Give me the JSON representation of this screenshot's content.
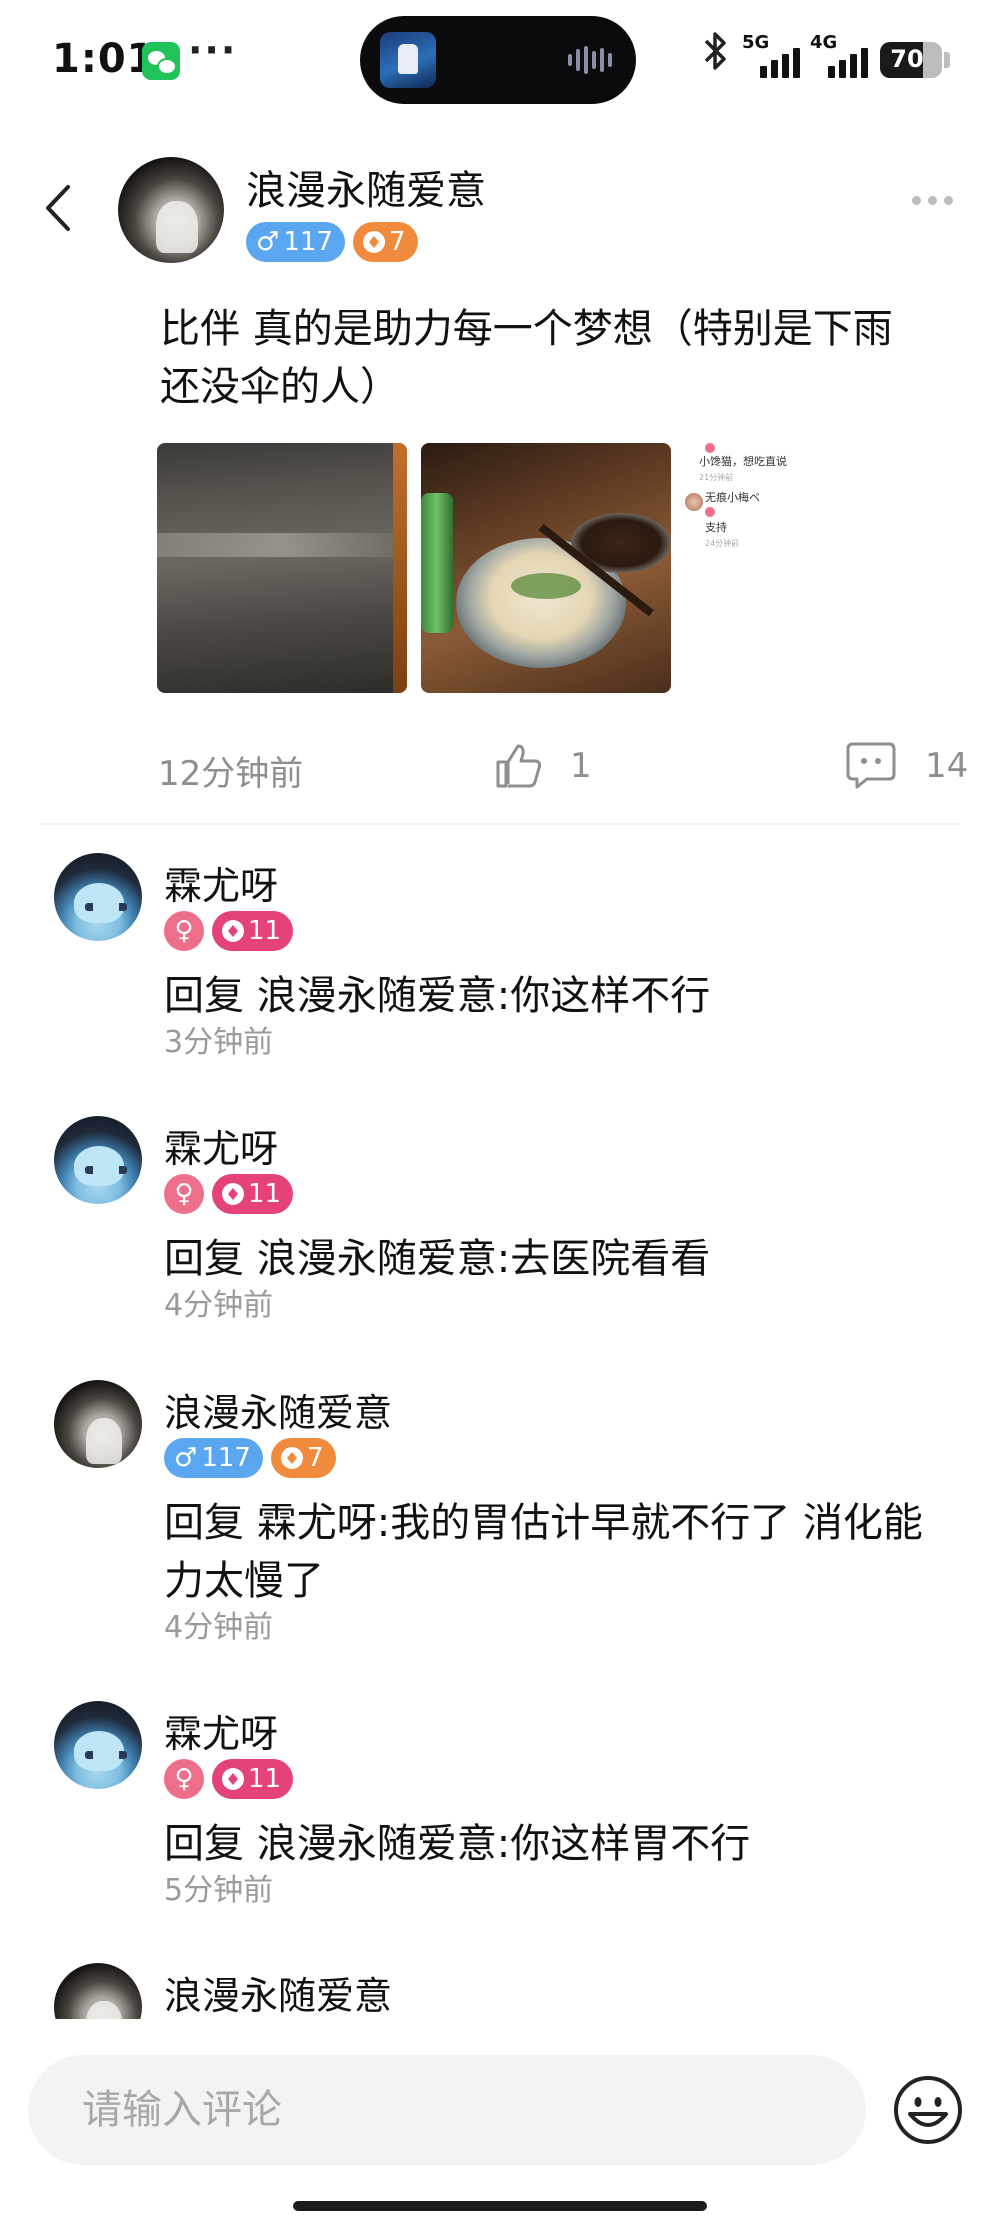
{
  "status_bar": {
    "time": "1:01",
    "dots": "···",
    "signal1_label": "5G",
    "signal2_label": "4G",
    "battery_percent": "70",
    "battery_level": 0.7
  },
  "header": {
    "username": "浪漫永随爱意",
    "male_badge": "117",
    "level_badge": "7"
  },
  "post": {
    "text": "比伴 真的是助力每一个梦想（特别是下雨还没伞的人）",
    "screenshot_mini": {
      "line1": "小馋猫，想吃直说",
      "time1": "21分钟前",
      "line2_name": "无痕小梅ベ",
      "line2_text": "支持",
      "time2": "24分钟前"
    },
    "time_ago": "12分钟前",
    "like_count": "1",
    "comment_count": "14"
  },
  "comments": [
    {
      "name": "霖尤呀",
      "level": "11",
      "text": "回复 浪漫永随爱意:你这样不行",
      "time": "3分钟前"
    },
    {
      "name": "霖尤呀",
      "level": "11",
      "text": "回复 浪漫永随爱意:去医院看看",
      "time": "4分钟前"
    },
    {
      "name": "浪漫永随爱意",
      "male": "117",
      "level": "7",
      "text": "回复 霖尤呀:我的胃估计早就不行了 消化能力太慢了",
      "time": "4分钟前"
    },
    {
      "name": "霖尤呀",
      "level": "11",
      "text": "回复 浪漫永随爱意:你这样胃不行",
      "time": "5分钟前"
    },
    {
      "name": "浪漫永随爱意"
    }
  ],
  "input": {
    "placeholder": "请输入评论"
  },
  "colors": {
    "male_badge": "#5aa6f0",
    "level_orange": "#f08a3c",
    "female_badge": "#ee6f8a",
    "level_pink": "#e5417a",
    "meta_gray": "#8e8e8e"
  },
  "icons": [
    "wechat-icon",
    "bluetooth-icon",
    "signal-icon",
    "battery-icon",
    "back-icon",
    "more-icon",
    "like-icon",
    "comment-icon",
    "male-icon",
    "female-icon",
    "level-icon",
    "emoji-icon"
  ]
}
